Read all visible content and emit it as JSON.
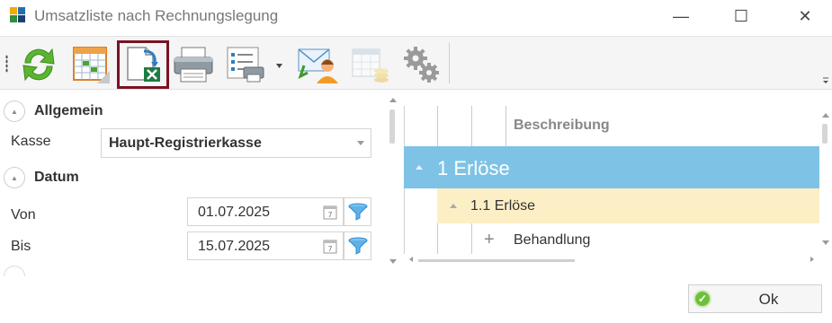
{
  "window": {
    "title": "Umsatzliste nach Rechnungslegung",
    "controls": {
      "minimize": "—",
      "maximize": "☐",
      "close": "✕"
    }
  },
  "toolbar": {
    "buttons": [
      {
        "icon": "refresh-icon"
      },
      {
        "icon": "calendar-grid-icon"
      },
      {
        "icon": "excel-export-icon",
        "selected": true
      },
      {
        "icon": "printer-icon"
      },
      {
        "icon": "print-list-icon"
      },
      {
        "icon": "email-contact-icon"
      },
      {
        "icon": "table-coins-icon"
      },
      {
        "icon": "settings-gears-icon"
      }
    ]
  },
  "filters": {
    "sections": {
      "allgemein": "Allgemein",
      "datum": "Datum"
    },
    "kasse": {
      "label": "Kasse",
      "value": "Haupt-Registrierkasse"
    },
    "von": {
      "label": "Von",
      "value": "01.07.2025"
    },
    "bis": {
      "label": "Bis",
      "value": "15.07.2025"
    }
  },
  "grid": {
    "column_header": "Beschreibung",
    "rows": {
      "group1": "1 Erlöse",
      "group2": "1.1 Erlöse",
      "row3": "Behandlung"
    }
  },
  "colors": {
    "selected_border": "#7a1224",
    "group1_bg": "#7ec3e6",
    "group2_bg": "#fcefc5"
  },
  "footer": {
    "ok_label": "Ok"
  }
}
